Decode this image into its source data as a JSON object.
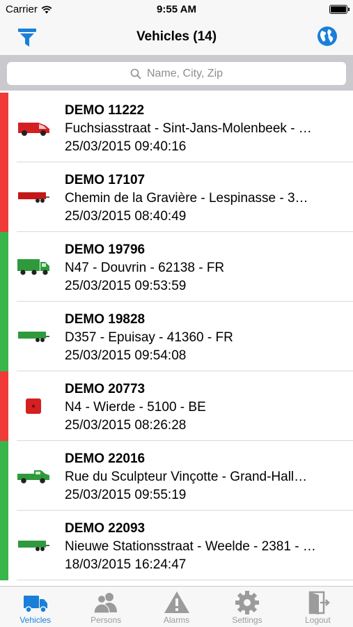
{
  "status_bar": {
    "carrier": "Carrier",
    "time": "9:55 AM"
  },
  "nav": {
    "title": "Vehicles (14)",
    "left_icon": "filter-icon",
    "right_icon": "globe-icon"
  },
  "search": {
    "placeholder": "Name, City, Zip"
  },
  "colors": {
    "accent": "#1a7fd9",
    "status_red": "#f03a3a",
    "status_green": "#39b54a"
  },
  "vehicles": [
    {
      "name": "DEMO 11222",
      "address": "Fuchsiasstraat - Sint-Jans-Molenbeek - …",
      "datetime": "25/03/2015 09:40:16",
      "status": "red",
      "icon": "van-icon",
      "icon_color": "#d42020"
    },
    {
      "name": "DEMO 17107",
      "address": "Chemin de la Gravière - Lespinasse - 3…",
      "datetime": "25/03/2015 08:40:49",
      "status": "red",
      "icon": "trailer-icon",
      "icon_color": "#c41818"
    },
    {
      "name": "DEMO 19796",
      "address": "N47 - Douvrin - 62138 - FR",
      "datetime": "25/03/2015 09:53:59",
      "status": "green",
      "icon": "truck-icon",
      "icon_color": "#2e9a3c"
    },
    {
      "name": "DEMO 19828",
      "address": "D357 - Epuisay - 41360 - FR",
      "datetime": "25/03/2015 09:54:08",
      "status": "green",
      "icon": "trailer-icon",
      "icon_color": "#2e9a3c"
    },
    {
      "name": "DEMO 20773",
      "address": "N4 - Wierde - 5100 - BE",
      "datetime": "25/03/2015 08:26:28",
      "status": "red",
      "icon": "box-icon",
      "icon_color": "#d42020"
    },
    {
      "name": "DEMO 22016",
      "address": "Rue du Sculpteur Vinçotte - Grand-Hall…",
      "datetime": "25/03/2015 09:55:19",
      "status": "green",
      "icon": "pickup-icon",
      "icon_color": "#2e9a3c"
    },
    {
      "name": "DEMO 22093",
      "address": "Nieuwe Stationsstraat - Weelde - 2381 - …",
      "datetime": "18/03/2015 16:24:47",
      "status": "green",
      "icon": "trailer-icon",
      "icon_color": "#2e9a3c"
    }
  ],
  "tabs": [
    {
      "label": "Vehicles",
      "icon": "truck-icon",
      "active": true
    },
    {
      "label": "Persons",
      "icon": "persons-icon",
      "active": false
    },
    {
      "label": "Alarms",
      "icon": "warning-icon",
      "active": false
    },
    {
      "label": "Settings",
      "icon": "gear-icon",
      "active": false
    },
    {
      "label": "Logout",
      "icon": "logout-icon",
      "active": false
    }
  ]
}
